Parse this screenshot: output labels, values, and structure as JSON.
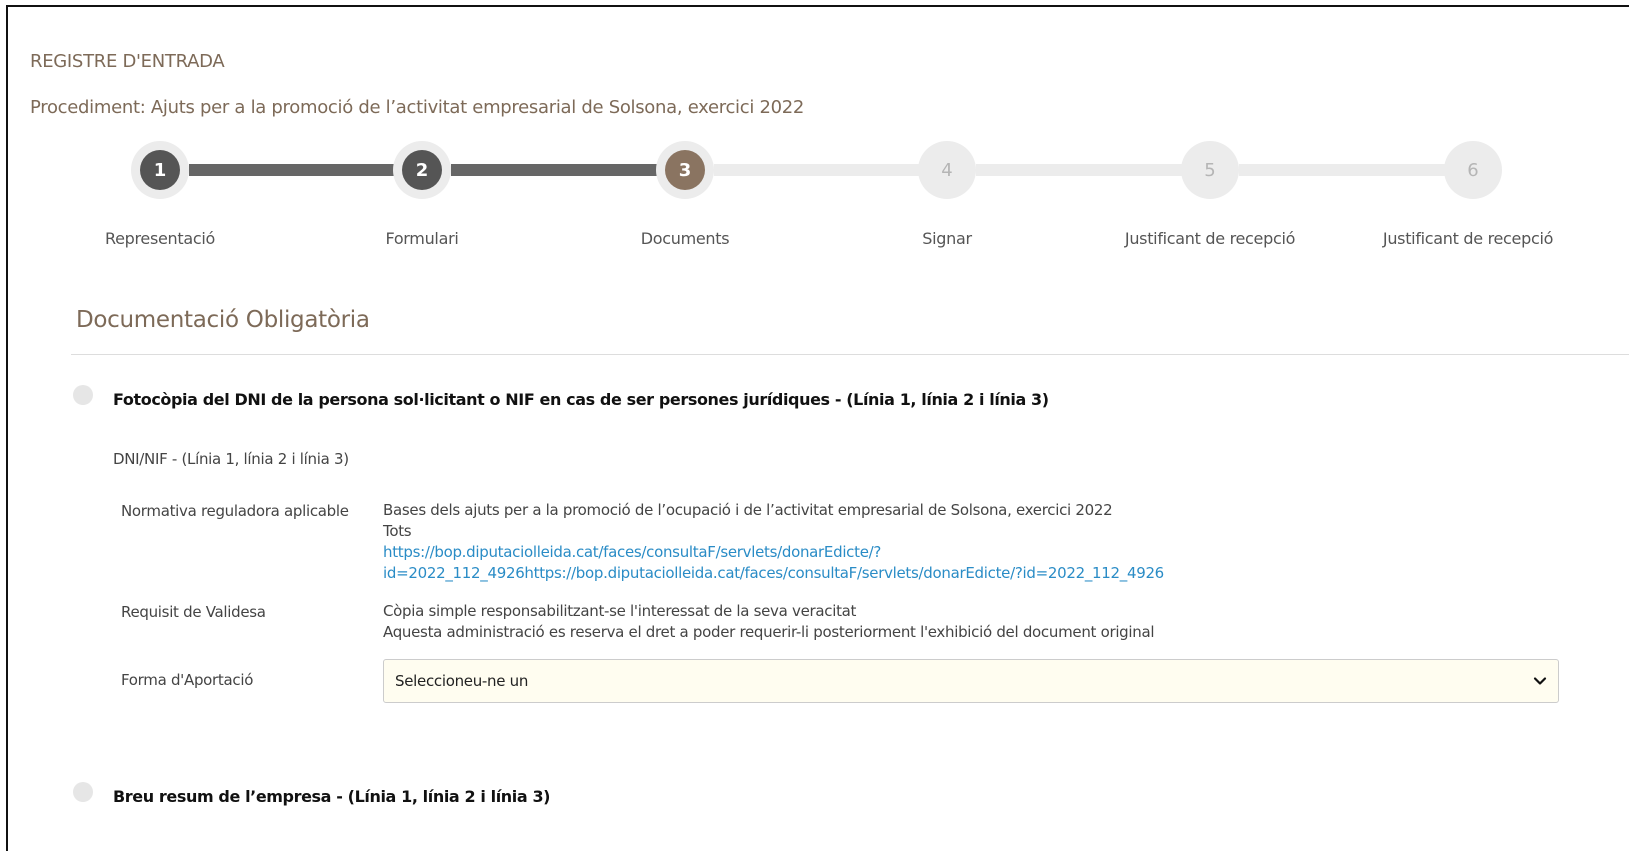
{
  "header": {
    "title": "REGISTRE D'ENTRADA",
    "procedure": "Procediment: Ajuts per a la promoció de l’activitat empresarial de Solsona, exercici 2022"
  },
  "stepper": {
    "current_step": 3,
    "steps": [
      {
        "number": "1",
        "label": "Representació",
        "state": "done"
      },
      {
        "number": "2",
        "label": "Formulari",
        "state": "done"
      },
      {
        "number": "3",
        "label": "Documents",
        "state": "active"
      },
      {
        "number": "4",
        "label": "Signar",
        "state": "todo"
      },
      {
        "number": "5",
        "label": "Justificant de recepció",
        "state": "todo"
      },
      {
        "number": "6",
        "label": "Justificant de recepció",
        "state": "todo"
      }
    ]
  },
  "section": {
    "title": "Documentació Obligatòria"
  },
  "documents": [
    {
      "title": "Fotocòpia del DNI de la persona sol·licitant o NIF en cas de ser persones jurídiques - (Línia 1, línia 2 i línia 3)",
      "subtitle": "DNI/NIF - (Línia 1, línia 2 i línia 3)",
      "normativa_label": "Normativa reguladora aplicable",
      "normativa_lines": [
        "Bases dels ajuts per a la promoció de l’ocupació i de l’activitat empresarial de Solsona, exercici 2022",
        "Tots"
      ],
      "normativa_link_lines": [
        "https://bop.diputaciolleida.cat/faces/consultaF/servlets/donarEdicte/?",
        "id=2022_112_4926https://bop.diputaciolleida.cat/faces/consultaF/servlets/donarEdicte/?id=2022_112_4926"
      ],
      "requisit_label": "Requisit de Validesa",
      "requisit_lines": [
        "Còpia simple responsabilitzant-se l'interessat de la seva veracitat",
        "Aquesta administració es reserva el dret a poder requerir-li posteriorment l'exhibició del document original"
      ],
      "forma_label": "Forma d'Aportació",
      "forma_selected": "Seleccioneu-ne un"
    },
    {
      "title": "Breu resum de l’empresa - (Línia 1, línia 2 i línia 3)"
    }
  ],
  "colors": {
    "accent": "#8a7461",
    "done": "#555555",
    "todo": "#ececec",
    "link": "#2a8cc6",
    "select_bg": "#fffdf0"
  },
  "icons": {
    "select_arrow": "chevron-down-icon"
  }
}
